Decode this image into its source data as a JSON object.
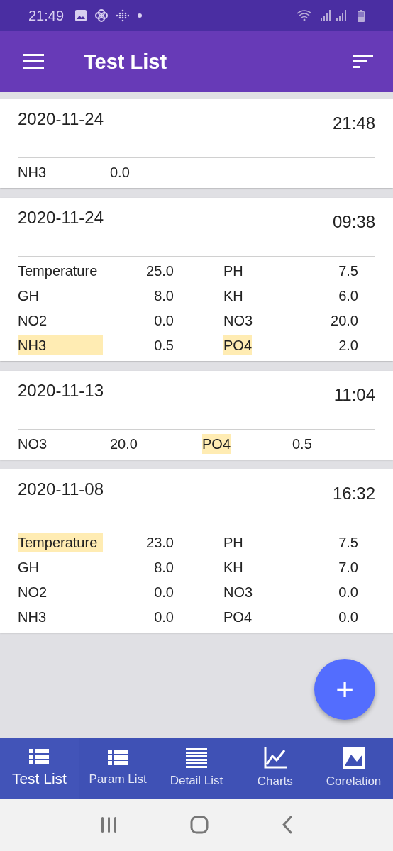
{
  "status_bar": {
    "time": "21:49"
  },
  "app_bar": {
    "title": "Test List"
  },
  "tests": [
    {
      "date": "2020-11-24",
      "time": "21:48",
      "kind": "row",
      "readings": [
        {
          "name": "NH3",
          "value": "0.0",
          "highlighted": false
        }
      ]
    },
    {
      "date": "2020-11-24",
      "time": "09:38",
      "kind": "grid",
      "readings": [
        {
          "name": "Temperature",
          "value": "25.0",
          "highlighted": false
        },
        {
          "name": "PH",
          "value": "7.5",
          "highlighted": false
        },
        {
          "name": "GH",
          "value": "8.0",
          "highlighted": false
        },
        {
          "name": "KH",
          "value": "6.0",
          "highlighted": false
        },
        {
          "name": "NO2",
          "value": "0.0",
          "highlighted": false
        },
        {
          "name": "NO3",
          "value": "20.0",
          "highlighted": false
        },
        {
          "name": "NH3",
          "value": "0.5",
          "highlighted": true
        },
        {
          "name": "PO4",
          "value": "2.0",
          "highlighted": true
        }
      ]
    },
    {
      "date": "2020-11-13",
      "time": "11:04",
      "kind": "row",
      "readings": [
        {
          "name": "NO3",
          "value": "20.0",
          "highlighted": false
        },
        {
          "name": "PO4",
          "value": "0.5",
          "highlighted": true
        }
      ]
    },
    {
      "date": "2020-11-08",
      "time": "16:32",
      "kind": "grid",
      "readings": [
        {
          "name": "Temperature",
          "value": "23.0",
          "highlighted": true
        },
        {
          "name": "PH",
          "value": "7.5",
          "highlighted": false
        },
        {
          "name": "GH",
          "value": "8.0",
          "highlighted": false
        },
        {
          "name": "KH",
          "value": "7.0",
          "highlighted": false
        },
        {
          "name": "NO2",
          "value": "0.0",
          "highlighted": false
        },
        {
          "name": "NO3",
          "value": "0.0",
          "highlighted": false
        },
        {
          "name": "NH3",
          "value": "0.0",
          "highlighted": false
        },
        {
          "name": "PO4",
          "value": "0.0",
          "highlighted": false
        }
      ]
    }
  ],
  "fab": {
    "label": "+"
  },
  "bottom_nav": [
    {
      "label": "Test List",
      "kind": "list",
      "selected": true
    },
    {
      "label": "Param List",
      "kind": "list",
      "selected": false
    },
    {
      "label": "Detail List",
      "kind": "lines",
      "selected": false
    },
    {
      "label": "Charts",
      "kind": "chart",
      "selected": false
    },
    {
      "label": "Corelation",
      "kind": "area",
      "selected": false
    }
  ]
}
